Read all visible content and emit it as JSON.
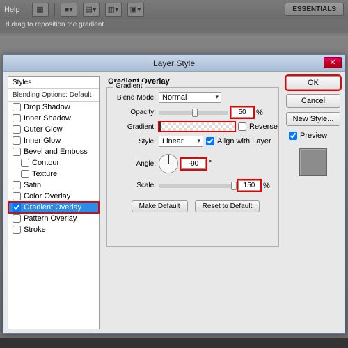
{
  "toolbar": {
    "help": "Help",
    "essentials": "ESSENTIALS"
  },
  "hint": "d drag to reposition the gradient.",
  "dialog": {
    "title": "Layer Style",
    "ok": "OK",
    "cancel": "Cancel",
    "new_style": "New Style...",
    "preview_label": "Preview"
  },
  "styles_panel": {
    "header": "Styles",
    "subheader": "Blending Options: Default",
    "items": [
      {
        "label": "Drop Shadow",
        "checked": false
      },
      {
        "label": "Inner Shadow",
        "checked": false
      },
      {
        "label": "Outer Glow",
        "checked": false
      },
      {
        "label": "Inner Glow",
        "checked": false
      },
      {
        "label": "Bevel and Emboss",
        "checked": false
      },
      {
        "label": "Contour",
        "checked": false,
        "indent": true
      },
      {
        "label": "Texture",
        "checked": false,
        "indent": true
      },
      {
        "label": "Satin",
        "checked": false
      },
      {
        "label": "Color Overlay",
        "checked": false
      },
      {
        "label": "Gradient Overlay",
        "checked": true,
        "active": true
      },
      {
        "label": "Pattern Overlay",
        "checked": false
      },
      {
        "label": "Stroke",
        "checked": false
      }
    ]
  },
  "gradient_overlay": {
    "title": "Gradient Overlay",
    "legend": "Gradient",
    "blend_mode_label": "Blend Mode:",
    "blend_mode_value": "Normal",
    "opacity_label": "Opacity:",
    "opacity_value": "50",
    "gradient_label": "Gradient:",
    "reverse_label": "Reverse",
    "style_label": "Style:",
    "style_value": "Linear",
    "align_label": "Align with Layer",
    "angle_label": "Angle:",
    "angle_value": "-90",
    "scale_label": "Scale:",
    "scale_value": "150",
    "make_default": "Make Default",
    "reset_default": "Reset to Default",
    "pct": "%",
    "deg": "°"
  }
}
